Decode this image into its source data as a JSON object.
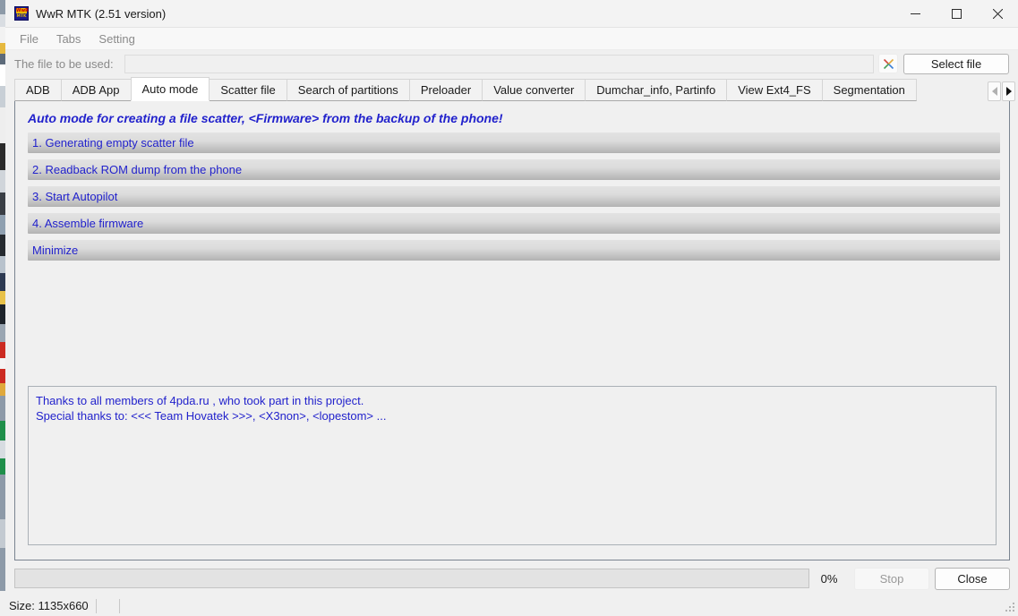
{
  "window": {
    "title": "WwR MTK (2.51 version)",
    "icon": "app-logo-icon",
    "logo_top": "WwR",
    "logo_bottom": "MTK",
    "minimize_label": "minimize-icon",
    "maximize_label": "maximize-icon",
    "close_label": "close-icon"
  },
  "menubar": {
    "items": [
      {
        "label": "File"
      },
      {
        "label": "Tabs"
      },
      {
        "label": "Setting"
      }
    ]
  },
  "filerow": {
    "label": "The file to be used:",
    "input_value": "",
    "input_placeholder": "",
    "clear_label": "X",
    "select_file_label": "Select file"
  },
  "tabs": {
    "items": [
      {
        "label": "ADB",
        "active": false
      },
      {
        "label": "ADB App",
        "active": false
      },
      {
        "label": "Auto mode",
        "active": true
      },
      {
        "label": "Scatter file",
        "active": false
      },
      {
        "label": "Search of partitions",
        "active": false
      },
      {
        "label": "Preloader",
        "active": false
      },
      {
        "label": "Value converter",
        "active": false
      },
      {
        "label": "Dumchar_info, Partinfo",
        "active": false
      },
      {
        "label": "View Ext4_FS",
        "active": false
      },
      {
        "label": "Segmentation",
        "active": false
      }
    ],
    "scroll_left_icon": "chevron-left-icon",
    "scroll_right_icon": "chevron-right-icon",
    "scroll_left_enabled": false,
    "scroll_right_enabled": true
  },
  "page": {
    "heading": "Auto mode for creating a file scatter, <Firmware> from the backup of the phone!",
    "buttons": [
      {
        "label": "1. Generating empty scatter file"
      },
      {
        "label": "2. Readback ROM dump from the phone"
      },
      {
        "label": "3. Start Autopilot"
      },
      {
        "label": "4. Assemble firmware"
      },
      {
        "label": "Minimize"
      }
    ],
    "log": "Thanks to all members of 4pda.ru , who took part in this project.\nSpecial thanks to: <<< Team Hovatek >>>, <X3non>, <lopestom> ..."
  },
  "bottom": {
    "progress_percent": 0,
    "progress_label": "0%",
    "stop_label": "Stop",
    "stop_enabled": false,
    "close_label": "Close"
  },
  "statusbar": {
    "size_text": "Size: 1135x660"
  },
  "colors": {
    "accent_text": "#2222cc",
    "window_bg": "#f0f0f0",
    "titlebar_bg": "#f3f3f3",
    "button_gradient_top": "#e2e2e2",
    "button_gradient_bottom": "#a8a8a8",
    "tab_active_bg": "#ffffff",
    "panel_border": "#7a8490"
  }
}
